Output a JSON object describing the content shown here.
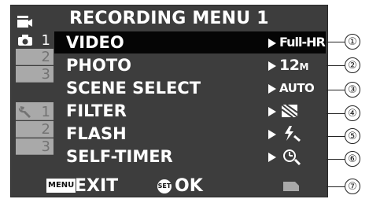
{
  "title": "RECORDING MENU 1",
  "sidebar": {
    "mode_icon": "movie-camera-icon",
    "tabs": [
      {
        "label": "1",
        "icon": "camera-icon",
        "active": true
      },
      {
        "label": "2",
        "active": false
      },
      {
        "label": "3",
        "active": false
      },
      {
        "label": "1",
        "icon": "wrench-icon",
        "active": false
      },
      {
        "label": "2",
        "active": false
      },
      {
        "label": "3",
        "active": false
      }
    ]
  },
  "menu": [
    {
      "label": "VIDEO",
      "value": "Full-HR",
      "selected": true
    },
    {
      "label": "PHOTO",
      "value": "12",
      "value_suffix": "M"
    },
    {
      "label": "SCENE SELECT",
      "value": "AUTO"
    },
    {
      "label": "FILTER",
      "value_icon": "filter-icon"
    },
    {
      "label": "FLASH",
      "value_icon": "flash-auto-icon"
    },
    {
      "label": "SELF-TIMER",
      "value_icon": "self-timer-icon"
    }
  ],
  "footer": {
    "menu_badge": "MENU",
    "exit_label": "EXIT",
    "set_badge": "SET",
    "ok_label": "OK",
    "card_icon": "memory-card-icon"
  },
  "callouts": [
    "①",
    "②",
    "③",
    "④",
    "⑤",
    "⑥",
    "⑦"
  ],
  "colors": {
    "screen_bg": "#3d3d3d",
    "selected_bg": "#050505",
    "inactive_tab_bg": "#a9a9a9",
    "text": "#ffffff"
  }
}
